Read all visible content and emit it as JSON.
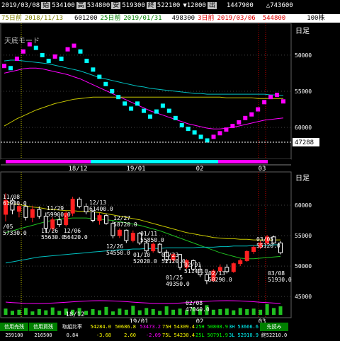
{
  "header": {
    "date": "2019/03/08",
    "open_label": "始",
    "open": "534100",
    "high_label": "高",
    "high": "534800",
    "low_label": "安",
    "low": "519300",
    "close_label": "終",
    "close": "522100",
    "change": "▼12000",
    "volume_label": "出",
    "volume": "1447900",
    "diff": "△743600"
  },
  "ma_row": {
    "ma75_label": "75日前",
    "ma75_date": "2018/11/13",
    "ma75_value": "601200",
    "ma25_label": "25日前",
    "ma25_date": "2019/01/31",
    "ma25_value": "498300",
    "ma3_label": "3日前",
    "ma3_date": "2019/03/06",
    "ma3_value": "544800",
    "shares": "100株"
  },
  "top_panel": {
    "title": "天底モード",
    "period_label": "日足",
    "marker_value": "47288",
    "y_ticks": [
      "60000",
      "55000",
      "50000"
    ]
  },
  "main_panel": {
    "period_label": "日足",
    "y_ticks": [
      "60000",
      "55000",
      "50000",
      "45000"
    ],
    "x_labels": [
      "18/12",
      "19/01",
      "02",
      "03"
    ],
    "annotations": [
      {
        "date": "11/08",
        "value": "61930.0"
      },
      {
        "date": "/05",
        "value": "57330.0"
      },
      {
        "date": "11/29",
        "value": "59900.0"
      },
      {
        "date": "11/26",
        "value": "55630.0"
      },
      {
        "date": "12/06",
        "value": "56420.0"
      },
      {
        "date": "12/13",
        "value": "61400.0"
      },
      {
        "date": "12/27",
        "value": "58720.0"
      },
      {
        "date": "12/26",
        "value": "54550.0"
      },
      {
        "date": "01/11",
        "value": "55850.0"
      },
      {
        "date": "01/10",
        "value": "52020.0"
      },
      {
        "date": "01/23",
        "value": "52120.0"
      },
      {
        "date": "01/25",
        "value": "49350.0"
      },
      {
        "date": "02/01",
        "value": "51140.0"
      },
      {
        "date": "02/13",
        "value": "50290.0"
      },
      {
        "date": "02/08",
        "value": "47040.0"
      },
      {
        "date": "03/05",
        "value": "55120.0"
      },
      {
        "date": "03/08",
        "value": "51930.0"
      }
    ]
  },
  "footer": {
    "c1_label": "信用売残",
    "c1_value": "259100",
    "c2_label": "信用買残",
    "c2_value": "216500",
    "c3_label": "取組比率",
    "c3_value": "0.84",
    "c4_a": "54284.0",
    "c4_b": "-3.68",
    "c5_a": "50686.8",
    "c5_b": "2.60",
    "c6_a": "53473.2",
    "c6_b": "-2.09",
    "c7_a_label": "75H",
    "c7_a": "54309.4",
    "c7_b_label": "75L",
    "c7_b": "54230.4",
    "c8_a_label": "25H",
    "c8_a": "50808.9",
    "c8_b_label": "25L",
    "c8_b": "50791.9",
    "c9_a_label": "3H",
    "c9_a": "53666.6",
    "c9_b_label": "3L",
    "c9_b": "52910.9",
    "c10_a": "先読み",
    "c10_b": "終52210.0"
  },
  "colors": {
    "ma75": "#c8c800",
    "ma25": "#ff00ff",
    "ma3": "#00c0c0",
    "up": "#ff2020",
    "down": "#ffffff",
    "volume": "#20c020"
  },
  "chart_data": [
    {
      "type": "line",
      "title": "天底モード",
      "y_ticks": [
        50000,
        55000,
        60000
      ],
      "ylim": [
        46000,
        64000
      ],
      "series": [
        {
          "values": [
            58500,
            58200,
            59500,
            60500,
            61500,
            61000,
            60000,
            59200,
            59800,
            59500,
            60800,
            61300,
            60500,
            59200,
            58000,
            57000,
            56000,
            55000,
            54200,
            53300,
            52600,
            53300,
            52300,
            51500,
            52200,
            53000,
            52300,
            51300,
            50300,
            49800,
            49300,
            48700,
            48200,
            48700,
            49200,
            49700,
            50200,
            50700,
            51300,
            51800,
            52500,
            53500,
            54200,
            54500,
            53600
          ]
        },
        {
          "values": [
            57500,
            57700,
            57900,
            58100,
            58200,
            58200,
            58100,
            57900,
            57700,
            57500,
            57300,
            57000,
            56700,
            56300,
            55900,
            55500,
            55100,
            54700,
            54300,
            53900,
            53500,
            53100,
            52700,
            52300,
            52000,
            51700,
            51400,
            51100,
            50800,
            50500,
            50300,
            50100,
            49900,
            49800,
            49800,
            49900,
            50000,
            50200,
            50400,
            50600,
            50800,
            51000,
            51100,
            51200,
            51300
          ]
        },
        {
          "values": [
            59200,
            59300,
            59300,
            59200,
            59100,
            59000,
            58900,
            58800,
            58600,
            58400,
            58200,
            58000,
            57800,
            57500,
            57200,
            56900,
            56700,
            56500,
            56300,
            56100,
            55900,
            55700,
            55600,
            55400,
            55300,
            55200,
            55100,
            55000,
            54900,
            54800,
            54700,
            54700,
            54600,
            54600,
            54600,
            54600,
            54600,
            54600,
            54600,
            54600,
            54600,
            54600,
            54500,
            54500,
            54400
          ]
        },
        {
          "values": [
            50200,
            50700,
            51200,
            51600,
            52000,
            52400,
            52700,
            53000,
            53300,
            53500,
            53700,
            53900,
            54000,
            54100,
            54200,
            54200,
            54200,
            54200,
            54200,
            54200,
            54200,
            54200,
            54200,
            54200,
            54200,
            54200,
            54200,
            54200,
            54200,
            54200,
            54200,
            54200,
            54200,
            54200,
            54200,
            54100,
            54100,
            54100,
            54100,
            54100,
            54000,
            54000,
            54000,
            54000,
            54000
          ]
        }
      ]
    },
    {
      "type": "candlestick",
      "y_ticks": [
        45000,
        50000,
        55000,
        60000
      ],
      "ylim": [
        42000,
        65000
      ],
      "x": [
        "18/12",
        "19/01",
        "02",
        "03"
      ],
      "candles": [
        [
          58500,
          61930,
          57330,
          60800
        ],
        [
          60800,
          61200,
          58500,
          59200
        ],
        [
          59000,
          60500,
          58000,
          59800
        ],
        [
          59800,
          60200,
          57500,
          58000
        ],
        [
          58000,
          59900,
          57200,
          59300
        ],
        [
          59300,
          59800,
          57800,
          58200
        ],
        [
          58200,
          58800,
          55630,
          56200
        ],
        [
          56200,
          58000,
          55800,
          57600
        ],
        [
          57600,
          58200,
          56420,
          56800
        ],
        [
          56800,
          59000,
          56500,
          58700
        ],
        [
          58700,
          61400,
          58200,
          61000
        ],
        [
          61000,
          61300,
          59500,
          59800
        ],
        [
          59800,
          60300,
          58500,
          58900
        ],
        [
          58900,
          59200,
          57200,
          57500
        ],
        [
          57500,
          58720,
          56800,
          58300
        ],
        [
          58300,
          58600,
          56800,
          57000
        ],
        [
          57000,
          57400,
          54550,
          55000
        ],
        [
          55000,
          56200,
          54600,
          55900
        ],
        [
          55900,
          56000,
          53800,
          54200
        ],
        [
          54200,
          55850,
          53900,
          55400
        ],
        [
          55400,
          55600,
          53500,
          53800
        ],
        [
          53800,
          54200,
          52020,
          52500
        ],
        [
          52500,
          53900,
          52200,
          53600
        ],
        [
          53600,
          53800,
          52100,
          52300
        ],
        [
          52300,
          52700,
          50500,
          51000
        ],
        [
          51000,
          52120,
          50600,
          51900
        ],
        [
          51900,
          52000,
          49350,
          49800
        ],
        [
          49800,
          51140,
          49500,
          50900
        ],
        [
          50900,
          51100,
          49200,
          49500
        ],
        [
          49500,
          50300,
          48200,
          48600
        ],
        [
          48600,
          48900,
          47040,
          47600
        ],
        [
          47600,
          49500,
          47400,
          49200
        ],
        [
          49200,
          50290,
          48700,
          49800
        ],
        [
          49800,
          50300,
          48800,
          49100
        ],
        [
          49100,
          50600,
          48900,
          50400
        ],
        [
          50400,
          51200,
          50000,
          50900
        ],
        [
          50900,
          52600,
          50700,
          52400
        ],
        [
          52400,
          53400,
          52000,
          53100
        ],
        [
          53100,
          54200,
          52800,
          53800
        ],
        [
          53800,
          55120,
          53500,
          54800
        ],
        [
          54800,
          55000,
          53600,
          53800
        ],
        [
          53800,
          54100,
          51930,
          52200
        ]
      ],
      "series": [
        {
          "values": [
            60500,
            60300,
            60100,
            59900,
            59700,
            59600,
            59400,
            59300,
            59200,
            59100,
            59100,
            59000,
            59000,
            58900,
            58800,
            58600,
            58400,
            58200,
            58000,
            57800,
            57600,
            57300,
            57000,
            56700,
            56400,
            56100,
            55800,
            55500,
            55300,
            55100,
            54900,
            54700,
            54600,
            54500,
            54500,
            54400,
            54400,
            54300,
            54300,
            54300,
            54300,
            54300
          ]
        },
        {
          "values": [
            55500,
            55800,
            56100,
            56400,
            56700,
            57000,
            57300,
            57500,
            57700,
            57800,
            57900,
            57900,
            57900,
            57800,
            57700,
            57600,
            57500,
            57300,
            57100,
            56900,
            56700,
            56400,
            56100,
            55800,
            55400,
            55000,
            54600,
            54200,
            53800,
            53400,
            53000,
            52600,
            52200,
            51900,
            51600,
            51300,
            51200,
            51200,
            51300,
            51400,
            51500,
            51600
          ]
        },
        {
          "values": [
            50500,
            50700,
            50900,
            51100,
            51300,
            51500,
            51600,
            51700,
            51800,
            51900,
            52000,
            52100,
            52200,
            52300,
            52400,
            52500,
            52600,
            52700,
            52700,
            52800,
            52800,
            52900,
            52900,
            52900,
            53000,
            53000,
            53000,
            53000,
            53000,
            53100,
            53100,
            53100,
            53200,
            53200,
            53300,
            53300,
            53300,
            53400,
            53400,
            53400,
            53500,
            53500
          ]
        }
      ],
      "volume": [
        0.55,
        0.35,
        0.45,
        0.6,
        0.3,
        0.5,
        0.4,
        0.65,
        0.35,
        0.55,
        0.45,
        0.6,
        0.35,
        0.5,
        0.4,
        0.7,
        0.3,
        0.55,
        0.45,
        0.8,
        0.4,
        0.6,
        0.5,
        0.35,
        0.75,
        0.45,
        0.55,
        0.4,
        0.65,
        0.5,
        0.85,
        0.45,
        0.5,
        0.55,
        0.4,
        0.6,
        0.5,
        0.55,
        0.45,
        0.95,
        0.6,
        0.75
      ]
    }
  ]
}
